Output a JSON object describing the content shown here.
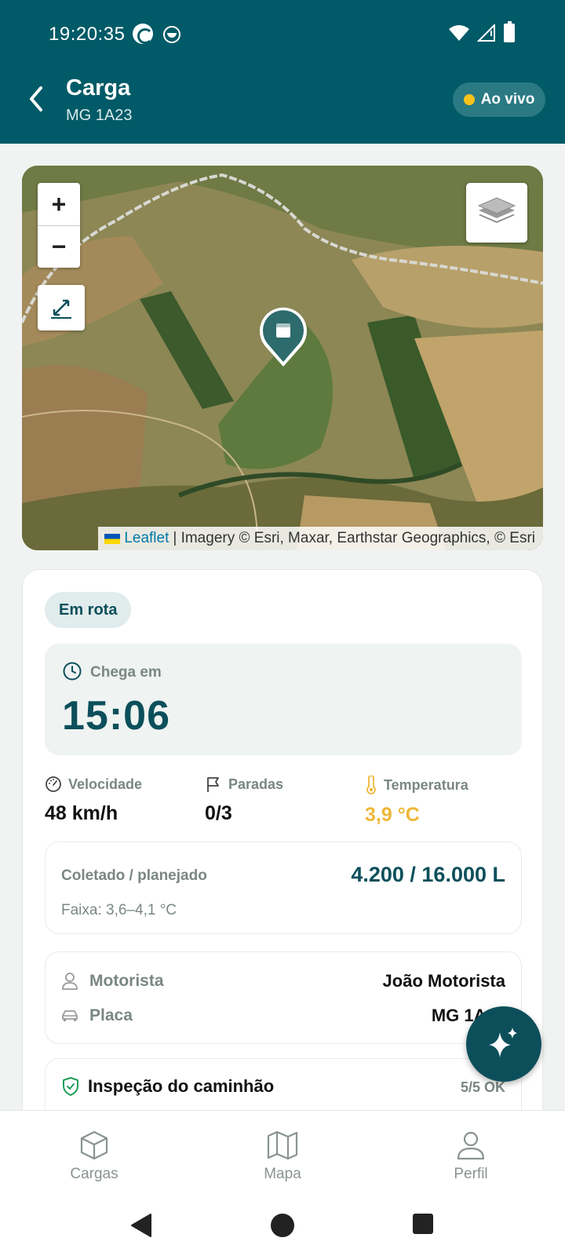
{
  "status_bar": {
    "time": "19:20:35"
  },
  "header": {
    "title": "Carga",
    "subtitle": "MG 1A23",
    "live_label": "Ao vivo"
  },
  "map": {
    "zoom_in": "+",
    "zoom_out": "−",
    "attribution_link": "Leaflet",
    "attribution_text": "| Imagery © Esri, Maxar, Earthstar Geographics, © Esri"
  },
  "card": {
    "status": "Em rota",
    "eta": {
      "label": "Chega em",
      "value": "15:06"
    },
    "metrics": {
      "speed": {
        "label": "Velocidade",
        "value": "48 km/h"
      },
      "stops": {
        "label": "Paradas",
        "value": "0/3"
      },
      "temperature": {
        "label": "Temperatura",
        "value": "3,9 °C"
      }
    },
    "collected": {
      "label": "Coletado / planejado",
      "value": "4.200 / 16.000 L",
      "range": "Faixa: 3,6–4,1 °C"
    },
    "driver": {
      "label": "Motorista",
      "value": "João Motorista"
    },
    "plate": {
      "label": "Placa",
      "value": "MG 1A23"
    },
    "inspection": {
      "title": "Inspeção do caminhão",
      "count": "5/5 OK"
    }
  },
  "bottom_nav": [
    {
      "label": "Cargas"
    },
    {
      "label": "Mapa"
    },
    {
      "label": "Perfil"
    }
  ],
  "colors": {
    "primary": "#005a67",
    "accent_dark": "#0c4f5b",
    "live_dot": "#f7c21b",
    "temperature": "#efb738"
  }
}
